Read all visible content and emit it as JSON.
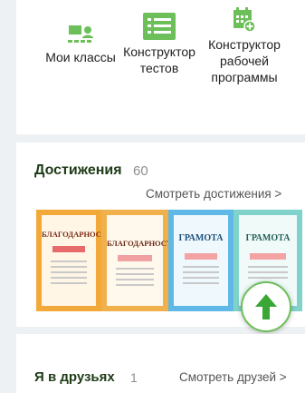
{
  "tools": [
    {
      "label": "Мои классы",
      "icon": "classes-icon"
    },
    {
      "label": "Конструктор тестов",
      "icon": "list-icon"
    },
    {
      "label": "Конструктор рабочей программы",
      "icon": "calendar-add-icon"
    }
  ],
  "achievements": {
    "title": "Достижения",
    "count": "60",
    "link": "Смотреть достижения >",
    "certificates": [
      {
        "heading": "БЛАГОДАРНОСТЬ",
        "style": "orange"
      },
      {
        "heading": "БЛАГОДАРНОСТЬ",
        "style": "orange"
      },
      {
        "heading": "ГРАМОТА",
        "style": "blue"
      },
      {
        "heading": "ГРАМОТА",
        "style": "teal"
      }
    ]
  },
  "friends": {
    "title": "Я в друзьях",
    "count": "1",
    "link": "Смотреть друзей >"
  },
  "colors": {
    "accent": "#6dbf5a",
    "title": "#1f3b17"
  }
}
